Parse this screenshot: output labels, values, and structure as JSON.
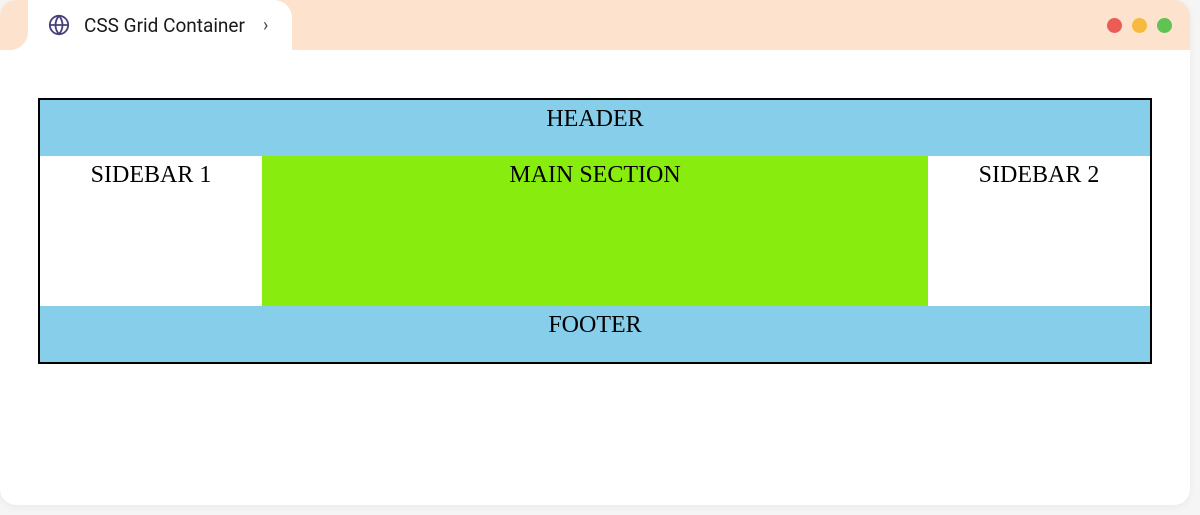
{
  "window": {
    "tab_title": "CSS Grid Container"
  },
  "grid": {
    "header": "HEADER",
    "sidebar1": "SIDEBAR 1",
    "main": "MAIN SECTION",
    "sidebar2": "SIDEBAR 2",
    "footer": "FOOTER"
  },
  "colors": {
    "header_bg": "#87ceeb",
    "main_bg": "#88ec0e",
    "sidebar_bg": "#ffffff",
    "footer_bg": "#87ceeb"
  }
}
